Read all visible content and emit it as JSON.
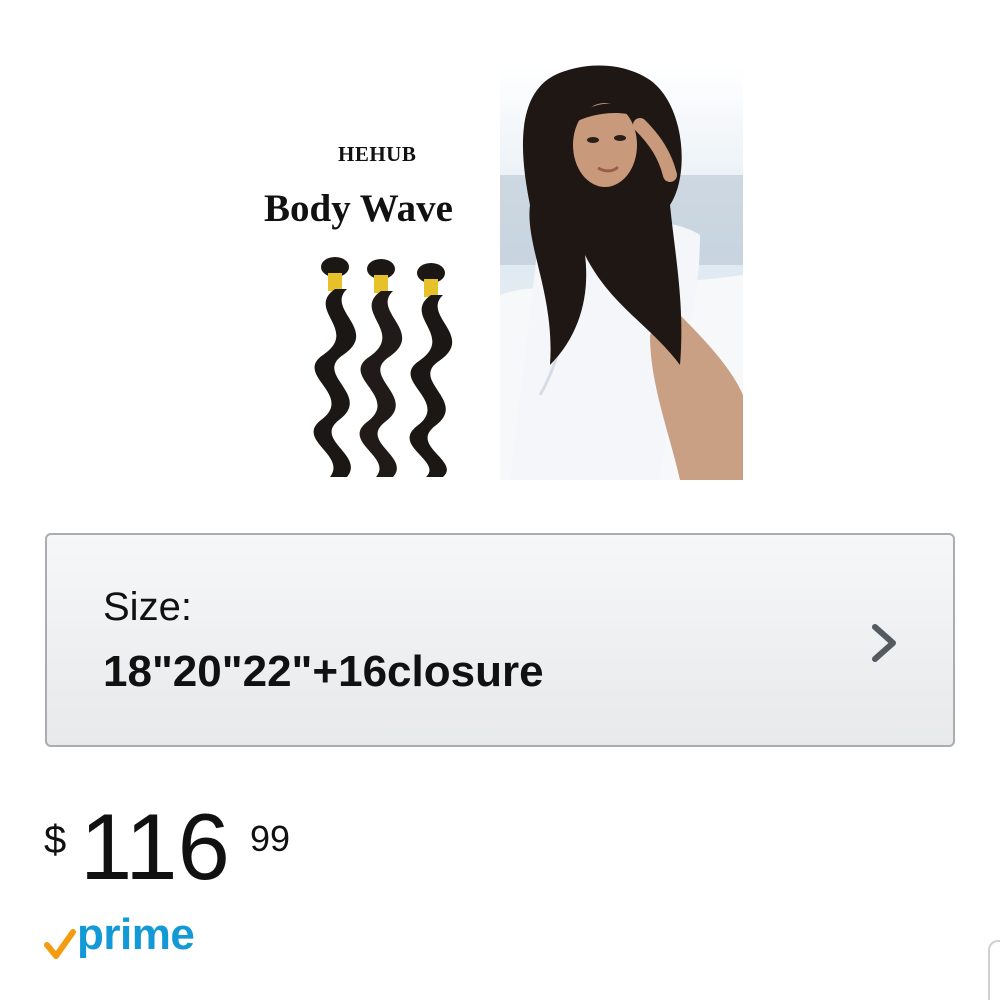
{
  "product": {
    "image": {
      "brand": "HEHUB",
      "style": "Body Wave"
    }
  },
  "size_selector": {
    "label": "Size:",
    "value": "18\"20\"22\"+16closure",
    "icon": "chevron-right-icon"
  },
  "price": {
    "currency": "$",
    "whole": "116",
    "fraction": "99"
  },
  "prime": {
    "label": "prime",
    "icon": "prime-check-icon",
    "color": "#1399d6",
    "check_color": "#f39c12"
  }
}
